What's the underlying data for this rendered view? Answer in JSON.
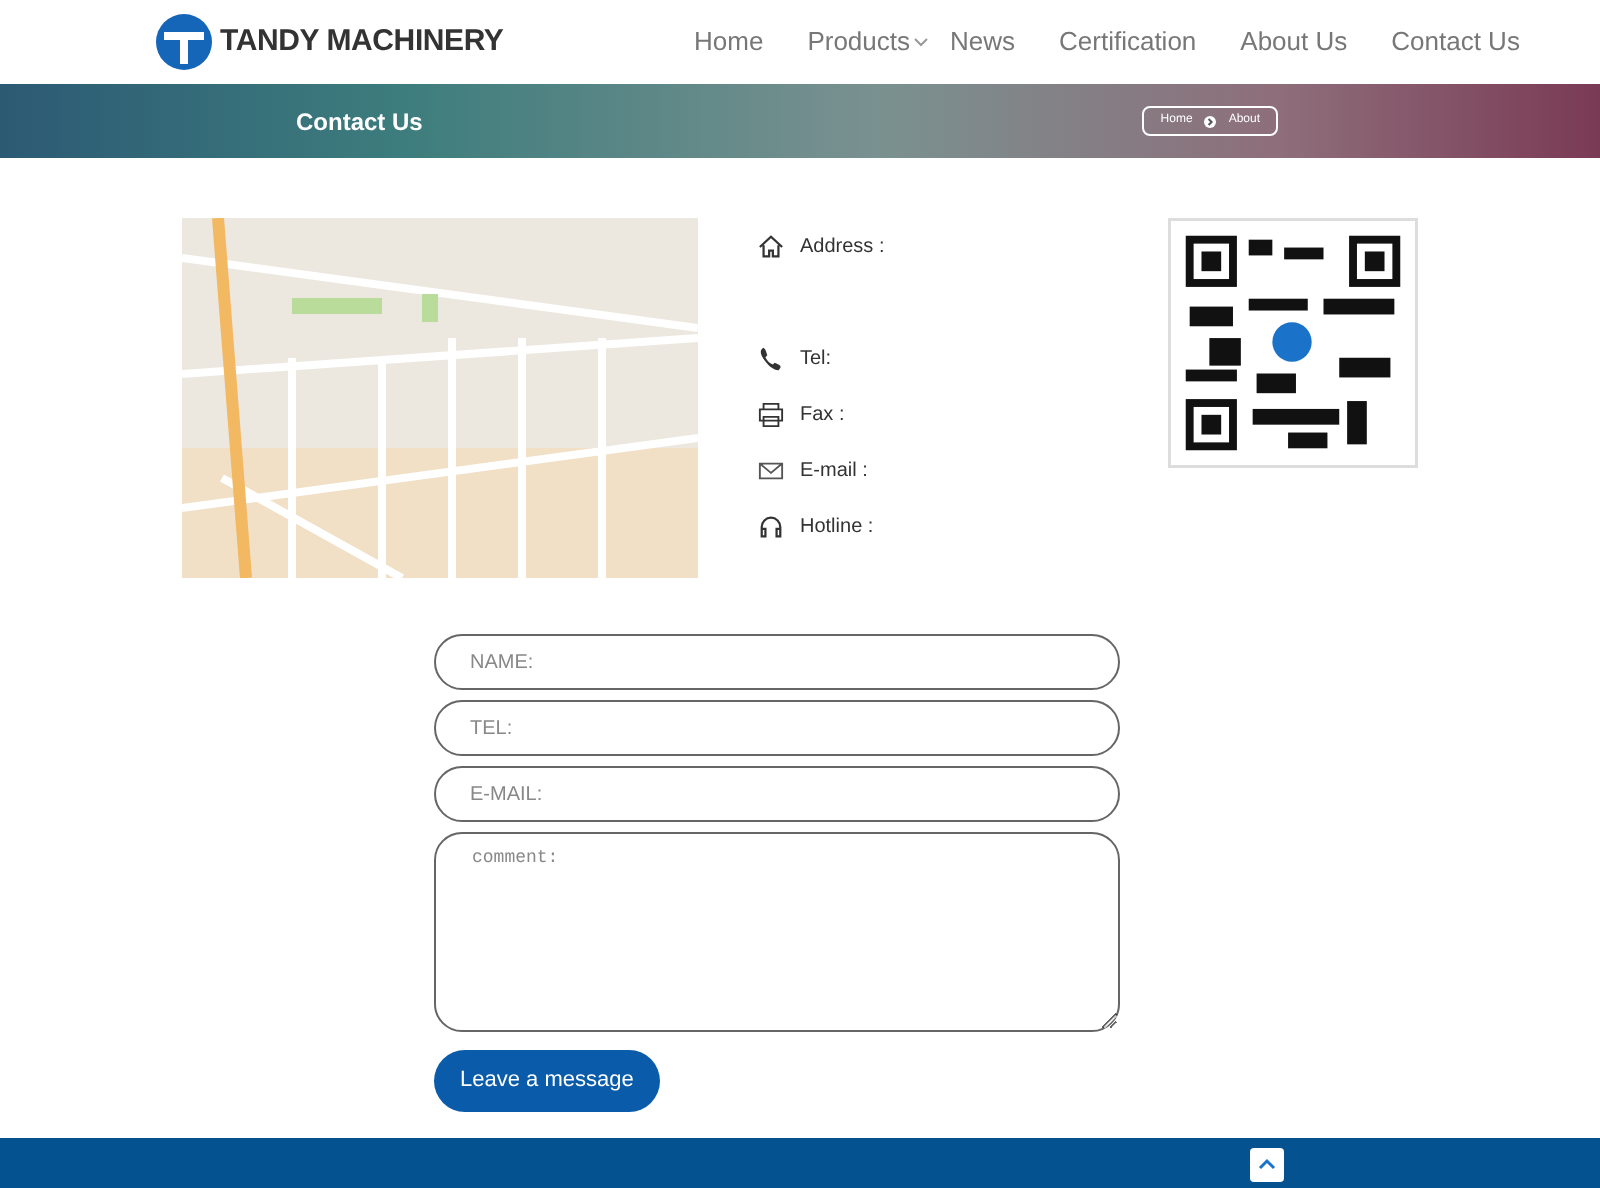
{
  "header": {
    "logo_text": "TANDY MACHINERY",
    "nav": [
      {
        "label": "Home",
        "has_dropdown": false
      },
      {
        "label": "Products",
        "has_dropdown": true
      },
      {
        "label": "News",
        "has_dropdown": false
      },
      {
        "label": "Certification",
        "has_dropdown": false
      },
      {
        "label": "About Us",
        "has_dropdown": false
      },
      {
        "label": "Contact Us",
        "has_dropdown": false
      }
    ]
  },
  "banner": {
    "title": "Contact Us",
    "breadcrumb": [
      "Home",
      "About"
    ]
  },
  "contact": [
    {
      "kind": "home",
      "label": "Address :"
    },
    {
      "kind": "phone",
      "label": "Tel:"
    },
    {
      "kind": "printer",
      "label": "Fax :"
    },
    {
      "kind": "mail",
      "label": "E-mail :"
    },
    {
      "kind": "headset",
      "label": "Hotline :"
    }
  ],
  "form": {
    "fields": [
      {
        "kind": "input",
        "placeholder": "NAME:"
      },
      {
        "kind": "input",
        "placeholder": "TEL:"
      },
      {
        "kind": "input",
        "placeholder": "E-MAIL:"
      },
      {
        "kind": "textarea",
        "placeholder": "comment:"
      }
    ],
    "submit": "Leave a message"
  }
}
